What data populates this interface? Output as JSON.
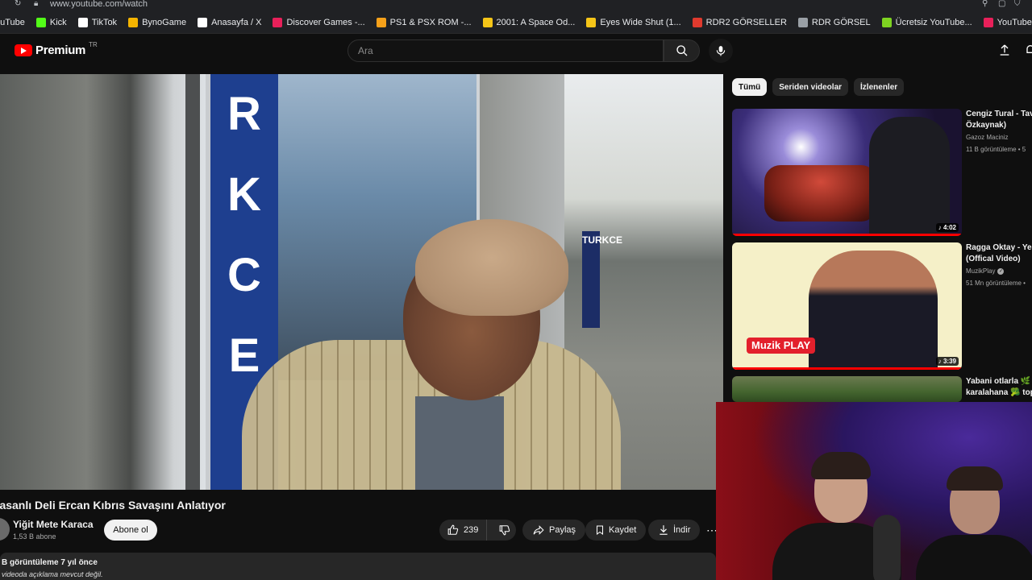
{
  "browser": {
    "url": "www.youtube.com/watch"
  },
  "bookmarks": [
    {
      "label": "ouTube",
      "icon": "youtube-icon",
      "color": "#ff0000"
    },
    {
      "label": "Kick",
      "icon": "kick-icon",
      "color": "#53fc18"
    },
    {
      "label": "TikTok",
      "icon": "tiktok-icon",
      "color": "#ffffff"
    },
    {
      "label": "BynoGame",
      "icon": "bynogame-icon",
      "color": "#f5b400"
    },
    {
      "label": "Anasayfa / X",
      "icon": "x-icon",
      "color": "#ffffff"
    },
    {
      "label": "Discover Games -...",
      "icon": "games-icon",
      "color": "#e8205a"
    },
    {
      "label": "PS1 & PSX ROM -...",
      "icon": "rom-icon",
      "color": "#f6a11a"
    },
    {
      "label": "2001: A Space Od...",
      "icon": "imdb-icon",
      "color": "#f5c518"
    },
    {
      "label": "Eyes Wide Shut (1...",
      "icon": "imdb-icon",
      "color": "#f5c518"
    },
    {
      "label": "RDR2 GÖRSELLER",
      "icon": "rdr-icon",
      "color": "#e03a2e"
    },
    {
      "label": "RDR GÖRSEL",
      "icon": "folder-icon",
      "color": "#9aa0a6"
    },
    {
      "label": "Ücretsiz YouTube...",
      "icon": "download-icon",
      "color": "#7ed321"
    },
    {
      "label": "YouTube Shorts İn...",
      "icon": "shorts-icon",
      "color": "#e8205a"
    }
  ],
  "header": {
    "logo_text": "Premium",
    "logo_region": "TR",
    "search_placeholder": "Ara"
  },
  "video": {
    "sign_letters": [
      "R",
      "K",
      "C",
      "E"
    ],
    "street_sign": "TURKCE",
    "title": "rasanlı Deli Ercan Kıbrıs Savaşını Anlatıyor",
    "channel": "Yiğit Mete Karaca",
    "subscribers": "1,53 B abone",
    "subscribe_label": "Abone ol",
    "likes": "239",
    "share_label": "Paylaş",
    "save_label": "Kaydet",
    "download_label": "İndir",
    "views": "B görüntüleme  7 yıl önce",
    "description": "videoda açıklama mevcut değil."
  },
  "sidebar": {
    "chips": [
      "Tümü",
      "Seriden videolar",
      "İzlenenler"
    ],
    "recommendations": [
      {
        "title_line1": "Cengiz Tural - Tav",
        "title_line2": "Özkaynak)",
        "channel": "Gazoz Maciniz",
        "meta": "11 B görüntüleme • 5",
        "duration": "4:02",
        "verified": false
      },
      {
        "title_line1": "Ragga Oktay - Yer",
        "title_line2": "(Offical Video)",
        "channel": "MuzikPlay",
        "meta": "51 Mn görüntüleme •",
        "duration": "3:39",
        "verified": true,
        "thumb_text": "Muzik PLAY"
      },
      {
        "title_line1": "Yabani otlarla 🌿 k",
        "title_line2": "karalahana 🥦 topl",
        "channel": "",
        "meta": "",
        "duration": "",
        "verified": false
      }
    ]
  },
  "colors": {
    "background": "#0f0f0f",
    "accent": "#ff0000",
    "chip_active": "#f1f1f1",
    "button_bg": "#272727"
  }
}
